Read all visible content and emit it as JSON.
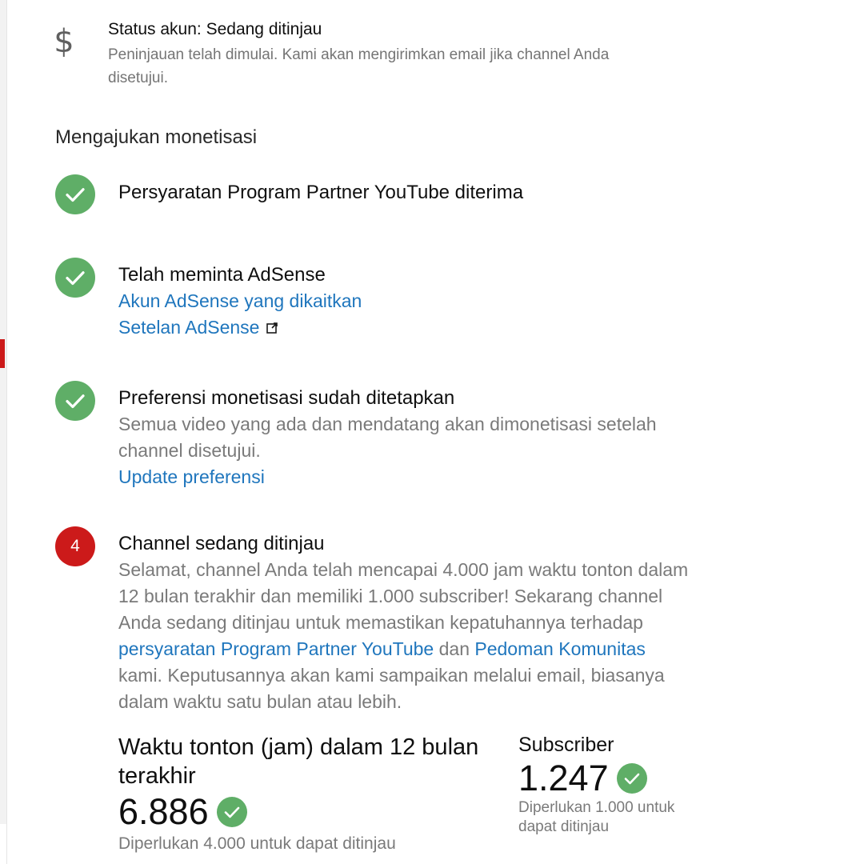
{
  "status": {
    "icon": "dollar-icon",
    "title": "Status akun: Sedang ditinjau",
    "description": "Peninjauan telah dimulai. Kami akan mengirimkan email jika channel Anda disetujui."
  },
  "section_heading": "Mengajukan monetisasi",
  "steps": [
    {
      "icon": "checkmark-icon",
      "title": "Persyaratan Program Partner YouTube diterima"
    },
    {
      "icon": "checkmark-icon",
      "title": "Telah meminta AdSense",
      "links": [
        "Akun AdSense yang dikaitkan",
        "Setelan AdSense"
      ]
    },
    {
      "icon": "checkmark-icon",
      "title": "Preferensi monetisasi sudah ditetapkan",
      "text": "Semua video yang ada dan mendatang akan dimonetisasi setelah channel disetujui.",
      "link": "Update preferensi"
    },
    {
      "number": "4",
      "title": "Channel sedang ditinjau",
      "text_1": "Selamat, channel Anda telah mencapai 4.000 jam waktu tonton dalam 12 bulan terakhir dan memiliki 1.000 subscriber! Sekarang channel Anda sedang ditinjau untuk memastikan kepatuhannya terhadap ",
      "link_1": "persyaratan Program Partner YouTube",
      "text_2": " dan ",
      "link_2": "Pedoman Komunitas",
      "text_3": " kami. Keputusannya akan kami sampaikan melalui email, biasanya dalam waktu satu bulan atau lebih."
    }
  ],
  "stats": {
    "watch_time": {
      "label": "Waktu tonton (jam) dalam 12 bulan terakhir",
      "value": "6.886",
      "requirement": "Diperlukan 4.000 untuk dapat ditinjau"
    },
    "subscribers": {
      "label": "Subscriber",
      "value": "1.247",
      "requirement": "Diperlukan 1.000 untuk dapat ditinjau"
    }
  },
  "colors": {
    "success": "#5fae67",
    "pending": "#cc1a1a",
    "link": "#1f76bd"
  }
}
